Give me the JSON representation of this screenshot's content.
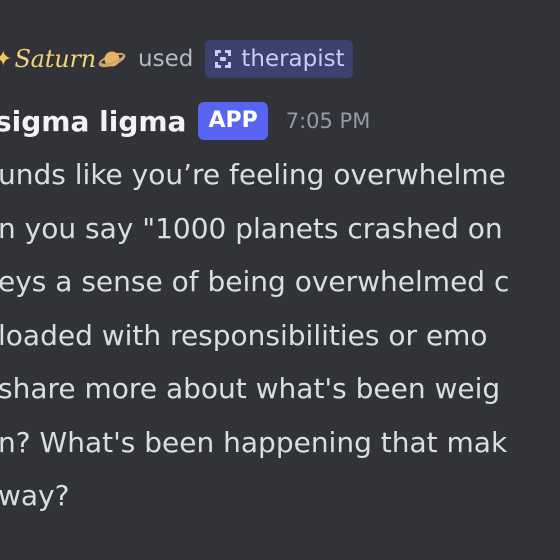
{
  "reply": {
    "username": "Saturn",
    "used_text": "used",
    "command_name": "therapist"
  },
  "icons": {
    "left_decoration": "star-icon",
    "planet": "planet-icon",
    "command": "app-command-icon"
  },
  "message": {
    "author": "sigma ligma",
    "badge": "APP",
    "timestamp": "7:05 PM",
    "lines": [
      "unds like you’re feeling overwhelme",
      "n you say \"1000 planets crashed on",
      "eys a sense of being overwhelmed c",
      "loaded with responsibilities or emo",
      "share more about what's been weig",
      "n? What's been happening that mak",
      "way?"
    ]
  },
  "colors": {
    "background": "#313338",
    "username_gold": "#f2d27a",
    "command_pill": "#3c4270",
    "command_text": "#c9cdfb",
    "badge": "#5865f2",
    "timestamp": "#949ba4",
    "body_text": "#dbdee1"
  }
}
